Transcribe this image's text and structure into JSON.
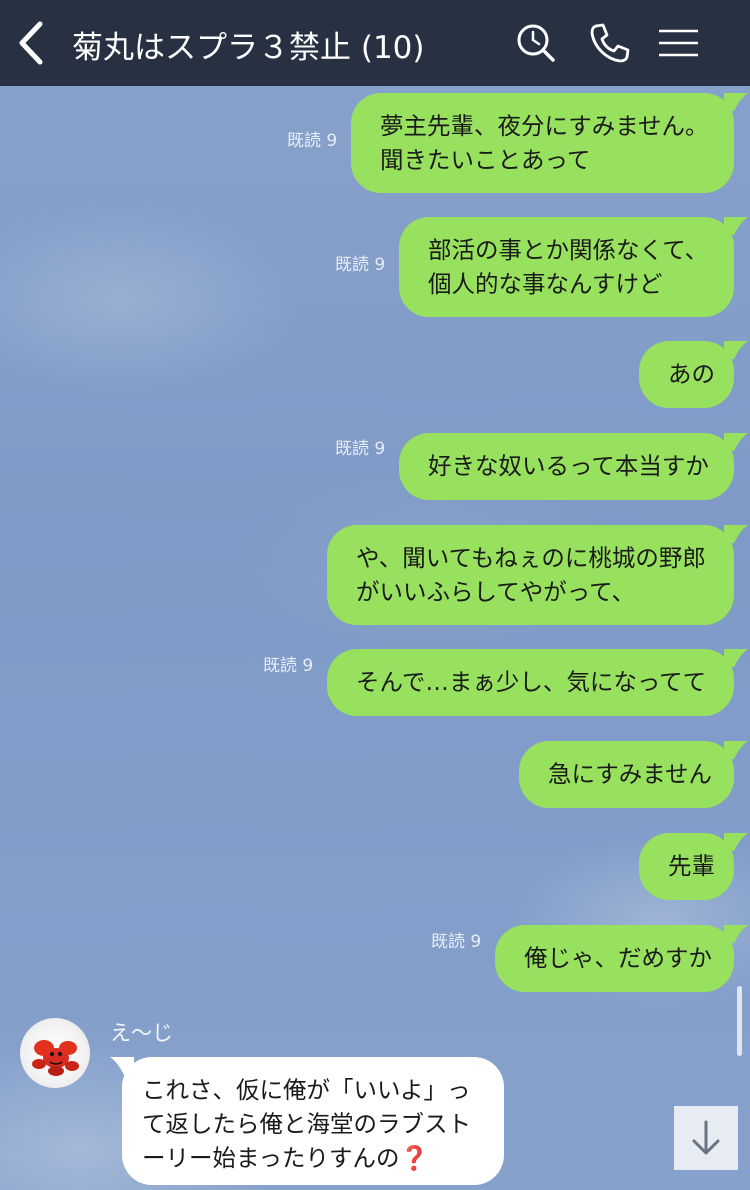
{
  "header": {
    "title": "菊丸はスプラ３禁止 (10)"
  },
  "icons": {
    "back": "back-chevron-icon",
    "search": "search-icon",
    "call": "phone-icon",
    "menu": "menu-icon",
    "scroll_down": "arrow-down-icon"
  },
  "colors": {
    "header_bg": "#283142",
    "outgoing_bubble": "#97e15f",
    "incoming_bubble": "#ffffff",
    "chat_bg": "#7f9bc6"
  },
  "messages": [
    {
      "read": "既読 9",
      "text_1": "夢主先輩、夜分にすみません。",
      "text_2": "聞きたいことあって"
    },
    {
      "read": "既読 9",
      "text_1": "部活の事とか関係なくて、",
      "text_2": "個人的な事なんすけど"
    },
    {
      "text_1": "あの"
    },
    {
      "read": "既読 9",
      "text_1": "好きな奴いるって本当すか"
    },
    {
      "text_1": "や、聞いてもねぇのに桃城の野郎",
      "text_2": "がいいふらしてやがって、"
    },
    {
      "read": "既読 9",
      "text_1": "そんで…まぁ少し、気になってて"
    },
    {
      "text_1": "急にすみません"
    },
    {
      "text_1": "先輩"
    },
    {
      "read": "既読 9",
      "text_1": "俺じゃ、だめすか"
    }
  ],
  "incoming": {
    "sender": "え〜じ",
    "text_1": "これさ、仮に俺が「いいよ」っ",
    "text_2": "て返したら俺と海堂のラブスト",
    "text_3": "ーリー始まったりすんの",
    "emoji": "❓"
  }
}
